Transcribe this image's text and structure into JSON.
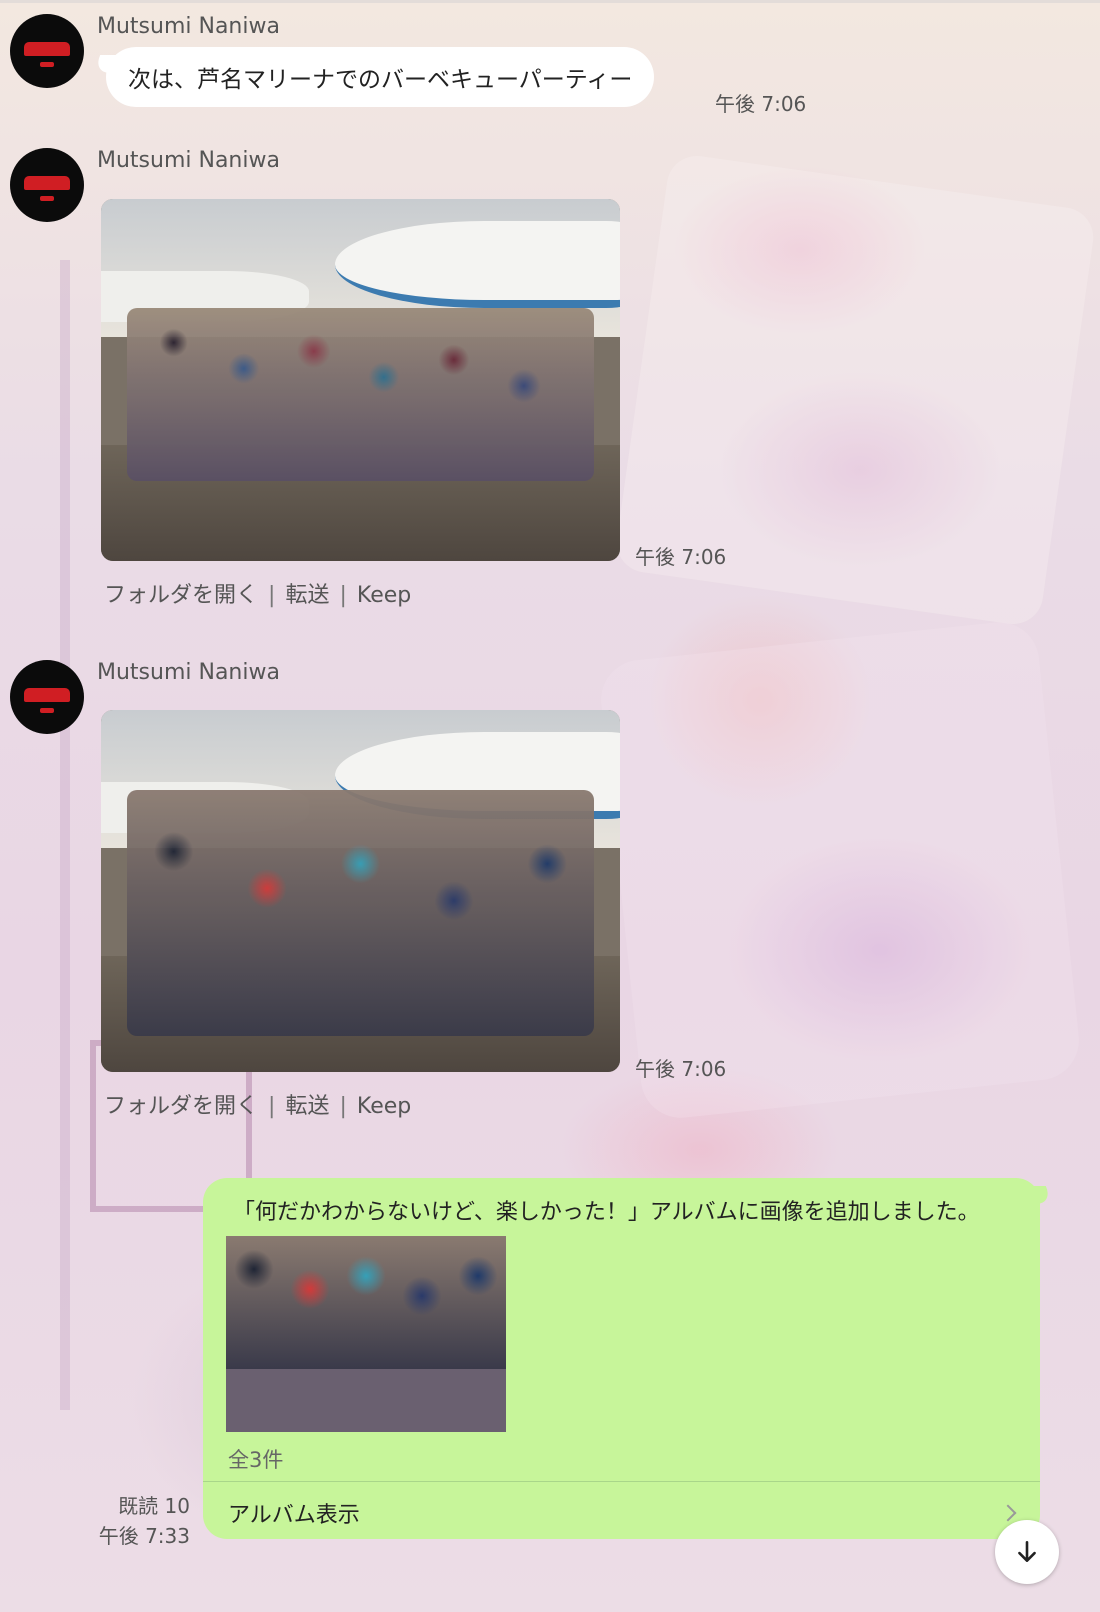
{
  "messages": [
    {
      "sender": "Mutsumi Naniwa",
      "text": "次は、芦名マリーナでのバーベキューパーティー",
      "time": "午後 7:06"
    },
    {
      "sender": "Mutsumi Naniwa",
      "time": "午後 7:06",
      "actions": [
        "フォルダを開く",
        "転送",
        "Keep"
      ]
    },
    {
      "sender": "Mutsumi Naniwa",
      "time": "午後 7:06",
      "actions": [
        "フォルダを開く",
        "転送",
        "Keep"
      ]
    }
  ],
  "outgoing": {
    "text": "「何だかわからないけど、楽しかった！」アルバムに画像を追加しました。",
    "count": "全3件",
    "album_link": "アルバム表示",
    "read": "既読 10",
    "time": "午後 7:33"
  },
  "separator": "|",
  "colors": {
    "outgoing_bubble": "#c7f59a",
    "incoming_bubble": "#ffffff"
  },
  "icons": {
    "scroll": "arrow-down-icon",
    "album": "chevron-right-icon"
  }
}
